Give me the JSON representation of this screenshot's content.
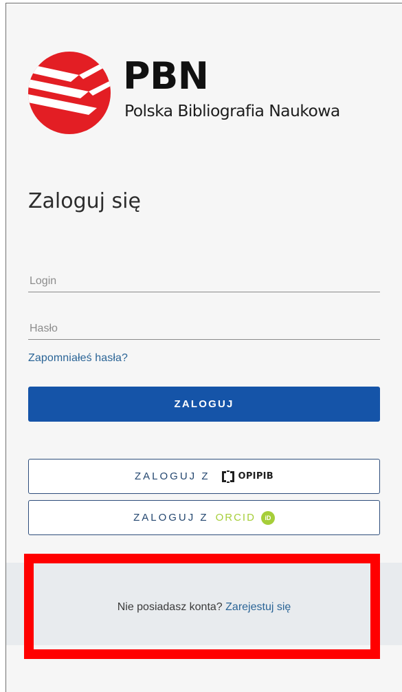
{
  "brand": {
    "title": "PBN",
    "subtitle": "Polska Bibliografia Naukowa",
    "logo_icon": "pbn-logo-icon",
    "accent_color": "#e31e24"
  },
  "login": {
    "heading": "Zaloguj się",
    "login_placeholder": "Login",
    "password_placeholder": "Hasło",
    "forgot_label": "Zapomniałeś hasła?",
    "submit_label": "ZALOGUJ",
    "primary_color": "#1554a8"
  },
  "external": {
    "opi_prefix": "ZALOGUJ Z",
    "opi_logo_text": "OPIPIB",
    "orcid_prefix": "ZALOGUJ Z",
    "orcid_word": "ORCID",
    "orcid_badge": "iD",
    "orcid_color": "#a6ce39"
  },
  "register": {
    "question": "Nie posiadasz konta?",
    "link_label": "Zarejestuj się"
  },
  "annotation": {
    "highlight_color": "#ff0000"
  }
}
